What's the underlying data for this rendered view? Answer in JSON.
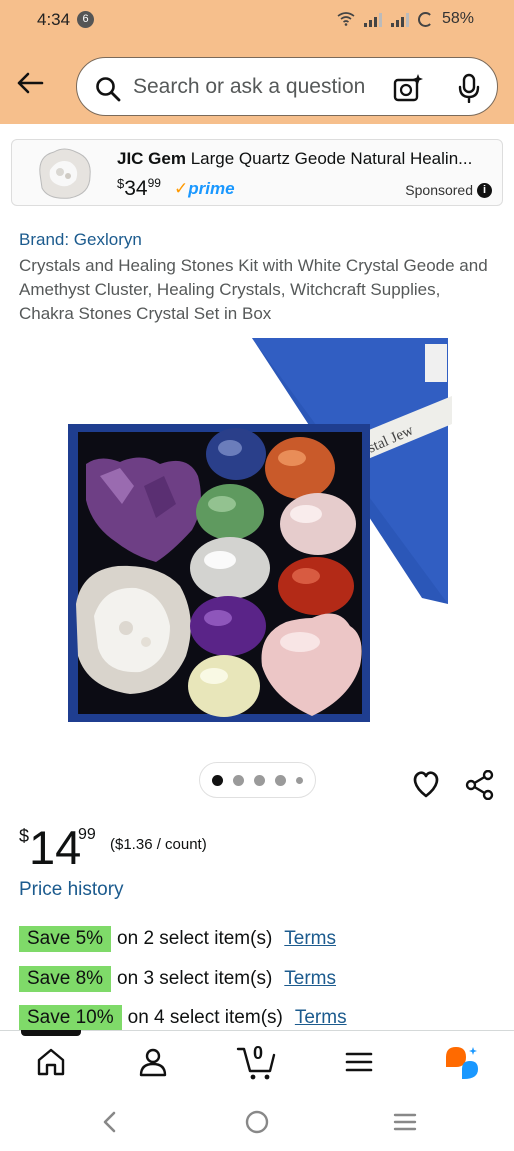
{
  "status_bar": {
    "time": "4:34",
    "notification_count": "6",
    "battery": "58%"
  },
  "search": {
    "placeholder": "Search or ask a question"
  },
  "sponsored_ad": {
    "brand": "JIC Gem",
    "title": "Large Quartz Geode Natural Healin...",
    "price_currency": "$",
    "price_whole": "34",
    "price_fraction": "99",
    "prime_label": "prime",
    "sponsored_label": "Sponsored"
  },
  "product": {
    "brand": "Brand: Gexloryn",
    "title": "Crystals and Healing Stones Kit with White Crystal Geode and Amethyst Cluster, Healing Crystals, Witchcraft Supplies, Chakra Stones Crystal Set in Box",
    "image_box_label": "Crystal Jew",
    "image_count": 5,
    "active_image_index": 0,
    "price_currency": "$",
    "price_whole": "14",
    "price_fraction": "99",
    "unit_price": "($1.36 / count)",
    "price_history_link": "Price history"
  },
  "promotions": [
    {
      "save": "Save 5%",
      "text": "on 2 select item(s)",
      "terms": "Terms"
    },
    {
      "save": "Save 8%",
      "text": "on 3 select item(s)",
      "terms": "Terms"
    },
    {
      "save": "Save 10%",
      "text": "on 4 select item(s)",
      "terms": "Terms"
    }
  ],
  "bottom_nav": {
    "cart_count": "0"
  },
  "colors": {
    "header_bg": "#f6bf8c",
    "link": "#1c5b8e",
    "save_badge": "#7fda69",
    "prime_blue": "#1a98ff",
    "rufus_orange": "#ff6a00",
    "rufus_blue": "#1a98ff"
  }
}
